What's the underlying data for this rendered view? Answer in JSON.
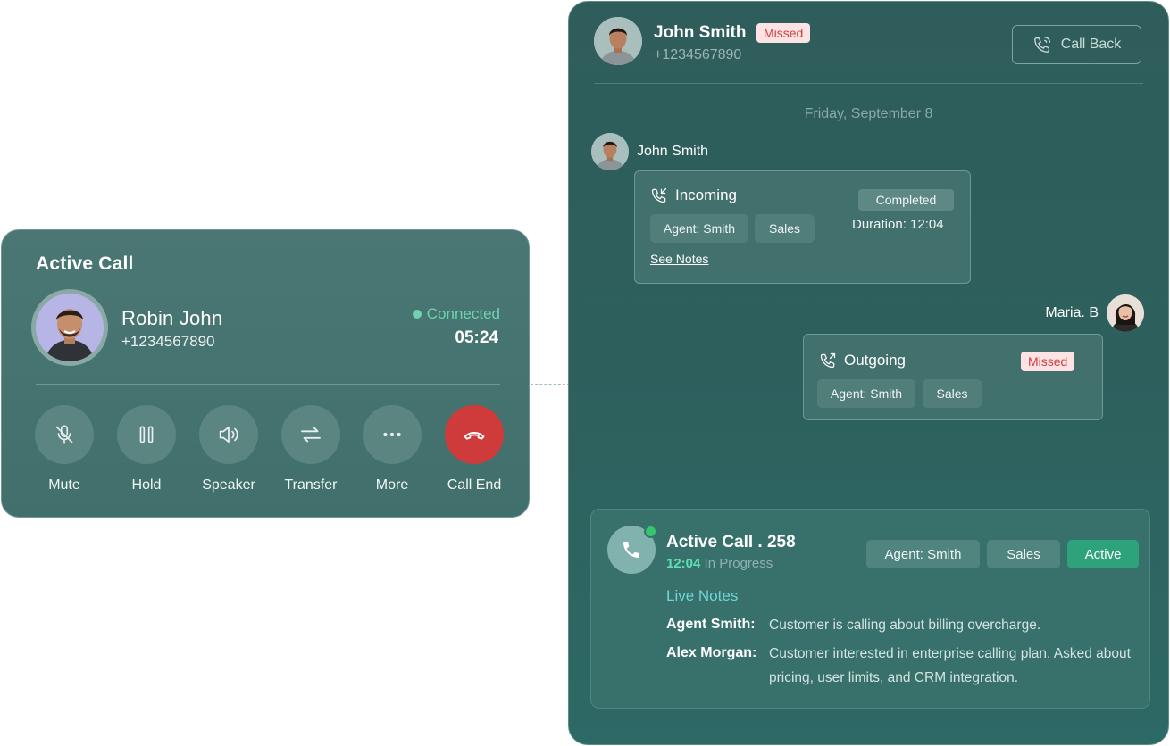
{
  "active_call_card": {
    "title": "Active Call",
    "caller_name": "Robin John",
    "caller_phone": "+1234567890",
    "status": "Connected",
    "duration": "05:24",
    "controls": [
      {
        "label": "Mute",
        "icon": "mic-off-icon"
      },
      {
        "label": "Hold",
        "icon": "pause-icon"
      },
      {
        "label": "Speaker",
        "icon": "speaker-icon"
      },
      {
        "label": "Transfer",
        "icon": "transfer-icon"
      },
      {
        "label": "More",
        "icon": "more-icon"
      },
      {
        "label": "Call End",
        "icon": "phone-hangup-icon"
      }
    ]
  },
  "history_panel": {
    "contact_name": "John Smith",
    "contact_badge": "Missed",
    "contact_phone": "+1234567890",
    "call_back_label": "Call Back",
    "date_label": "Friday, September 8",
    "messages": [
      {
        "sender": "John Smith",
        "direction": "Incoming",
        "status": "Completed",
        "duration": "Duration: 12:04",
        "tags": [
          "Agent: Smith",
          "Sales"
        ],
        "link": "See Notes"
      },
      {
        "sender": "Maria. B",
        "direction": "Outgoing",
        "status": "Missed",
        "tags": [
          "Agent: Smith",
          "Sales"
        ]
      }
    ],
    "active_call": {
      "title": "Active Call . 258",
      "elapsed": "12:04",
      "progress_text": "In Progress",
      "tags": [
        "Agent: Smith",
        "Sales"
      ],
      "state": "Active",
      "notes_heading": "Live Notes",
      "notes": [
        {
          "author": "Agent Smith:",
          "text": "Customer is calling about billing overcharge."
        },
        {
          "author": "Alex Morgan:",
          "text": "Customer interested in enterprise calling plan. Asked about pricing, user limits, and CRM integration."
        }
      ]
    }
  },
  "colors": {
    "accent_green": "#6fd3b1",
    "end_call_red": "#cf3b3b",
    "missed_bg": "#fde3e3",
    "missed_text": "#d13c3c",
    "active_badge": "#2ea27a",
    "online_dot": "#35c56c"
  }
}
